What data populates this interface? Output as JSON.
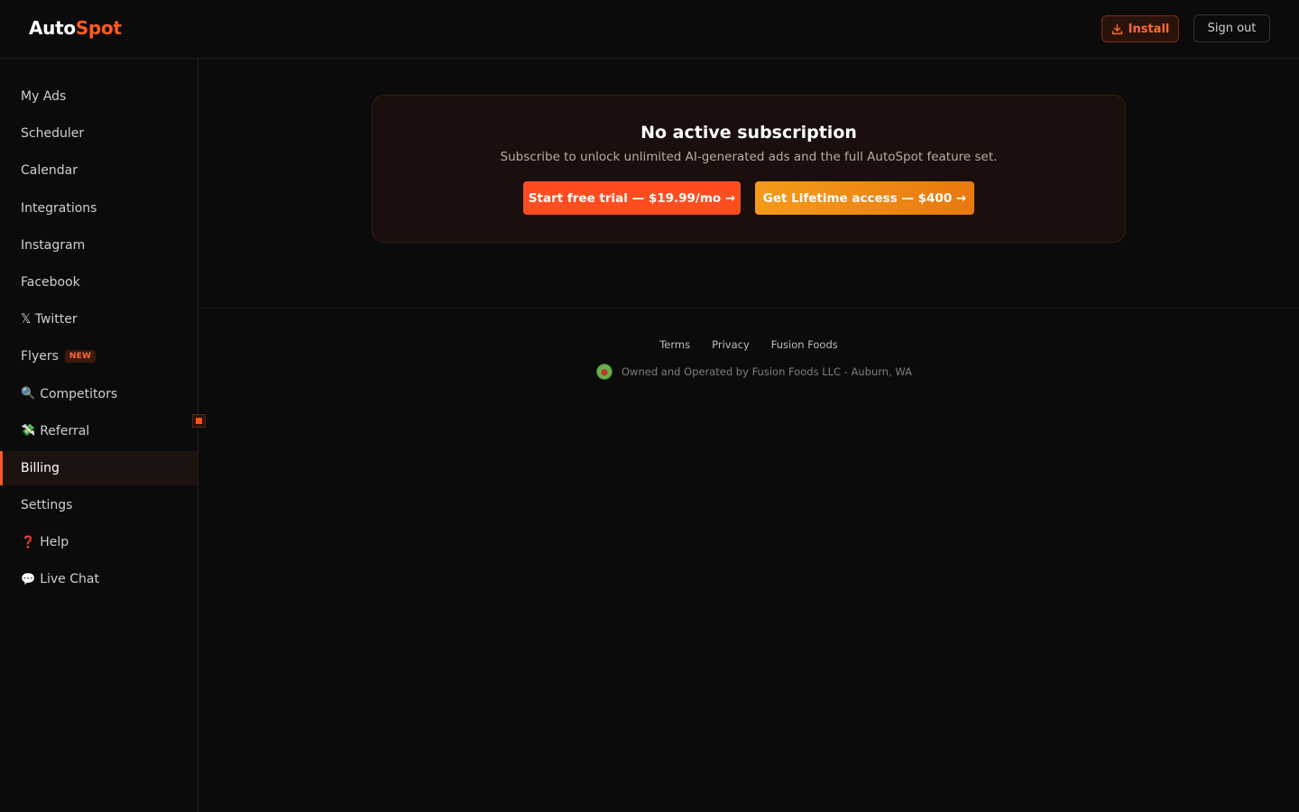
{
  "header": {
    "logo_part1": "Auto",
    "logo_part2": "Spot",
    "install_label": "Install",
    "signout_label": "Sign out"
  },
  "sidebar": {
    "items": [
      {
        "label": "My Ads"
      },
      {
        "label": "Scheduler"
      },
      {
        "label": "Calendar"
      },
      {
        "label": "Integrations"
      },
      {
        "label": "Instagram"
      },
      {
        "label": "Facebook"
      },
      {
        "label": "𝕏 Twitter"
      },
      {
        "label": "Flyers",
        "badge": "NEW"
      },
      {
        "label": "Competitors",
        "emoji": "🔍"
      },
      {
        "label": "Referral",
        "emoji": "💸"
      },
      {
        "label": "Billing",
        "active": true
      },
      {
        "label": "Settings"
      },
      {
        "label": "Help",
        "emoji": "❓"
      },
      {
        "label": "Live Chat",
        "emoji": "💬"
      }
    ]
  },
  "subscription": {
    "title": "No active subscription",
    "subtitle": "Subscribe to unlock unlimited AI-generated ads and the full AutoSpot feature set.",
    "trial_label": "Start free trial — $19.99/mo →",
    "lifetime_label": "Get Lifetime access — $400 →"
  },
  "footer": {
    "links": [
      "Terms",
      "Privacy",
      "Fusion Foods"
    ],
    "owner_text": "Owned and Operated by Fusion Foods LLC - Auburn, WA"
  },
  "colors": {
    "accent": "#ff5a1f",
    "lifetime": "#f59a1a",
    "background": "#0b0b0b"
  }
}
